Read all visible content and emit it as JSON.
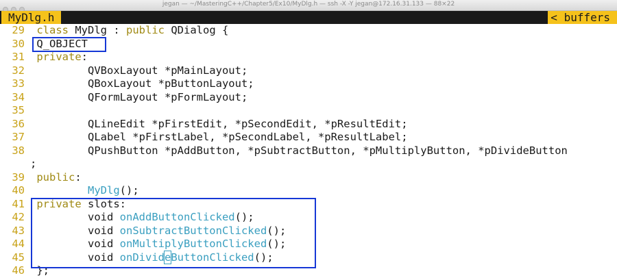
{
  "window": {
    "title": "jegan — ~/MasteringC++/Chapter5/Ex10/MyDlg.h — ssh -X -Y jegan@172.16.31.133 — 88×22"
  },
  "tabs": {
    "file": "MyDlg.h",
    "buffers_arrow": "<",
    "buffers": "buffers"
  },
  "lines": [
    {
      "n": "29",
      "tokens": [
        {
          "t": " "
        },
        {
          "t": "class",
          "c": "kw"
        },
        {
          "t": " MyDlg : "
        },
        {
          "t": "public",
          "c": "kw"
        },
        {
          "t": " QDialog {"
        }
      ]
    },
    {
      "n": "30",
      "tokens": [
        {
          "t": " Q_OBJECT"
        }
      ]
    },
    {
      "n": "31",
      "tokens": [
        {
          "t": " "
        },
        {
          "t": "private",
          "c": "kw"
        },
        {
          "t": ":"
        }
      ]
    },
    {
      "n": "32",
      "tokens": [
        {
          "t": "         QVBoxLayout *pMainLayout;"
        }
      ]
    },
    {
      "n": "33",
      "tokens": [
        {
          "t": "         QBoxLayout *pButtonLayout;"
        }
      ]
    },
    {
      "n": "34",
      "tokens": [
        {
          "t": "         QFormLayout *pFormLayout;"
        }
      ]
    },
    {
      "n": "35",
      "tokens": []
    },
    {
      "n": "36",
      "tokens": [
        {
          "t": "         QLineEdit *pFirstEdit, *pSecondEdit, *pResultEdit;"
        }
      ]
    },
    {
      "n": "37",
      "tokens": [
        {
          "t": "         QLabel *pFirstLabel, *pSecondLabel, *pResultLabel;"
        }
      ]
    },
    {
      "n": "38",
      "tokens": [
        {
          "t": "         QPushButton *pAddButton, *pSubtractButton, *pMultiplyButton, *pDivideButton"
        }
      ]
    },
    {
      "n": "",
      "tokens": [
        {
          "t": ";"
        }
      ]
    },
    {
      "n": "39",
      "tokens": [
        {
          "t": " "
        },
        {
          "t": "public",
          "c": "kw"
        },
        {
          "t": ":"
        }
      ]
    },
    {
      "n": "40",
      "tokens": [
        {
          "t": "         "
        },
        {
          "t": "MyDlg",
          "c": "fn"
        },
        {
          "t": "();"
        }
      ]
    },
    {
      "n": "41",
      "tokens": [
        {
          "t": " "
        },
        {
          "t": "private",
          "c": "kw"
        },
        {
          "t": " slots:"
        }
      ]
    },
    {
      "n": "42",
      "tokens": [
        {
          "t": "         void "
        },
        {
          "t": "onAddButtonClicked",
          "c": "fn"
        },
        {
          "t": "();"
        }
      ]
    },
    {
      "n": "43",
      "tokens": [
        {
          "t": "         void "
        },
        {
          "t": "onSubtractButtonClicked",
          "c": "fn"
        },
        {
          "t": "();"
        }
      ]
    },
    {
      "n": "44",
      "tokens": [
        {
          "t": "         void "
        },
        {
          "t": "onMultiplyButtonClicked",
          "c": "fn"
        },
        {
          "t": "();"
        }
      ]
    },
    {
      "n": "45",
      "tokens": [
        {
          "t": "         void "
        },
        {
          "t": "onDivid",
          "c": "fn"
        },
        {
          "t": "e",
          "c": "fn cursor"
        },
        {
          "t": "ButtonClicked",
          "c": "fn"
        },
        {
          "t": "();"
        }
      ]
    },
    {
      "n": "46",
      "tokens": [
        {
          "t": " };"
        }
      ]
    }
  ],
  "colors": {
    "line_numbers": "#c8a218",
    "keywords": "#a08a14",
    "functions": "#3a9fc0",
    "tab_background": "#f5c21b",
    "tab_bar": "#1a1a1a",
    "highlight_box": "#1537d6"
  }
}
